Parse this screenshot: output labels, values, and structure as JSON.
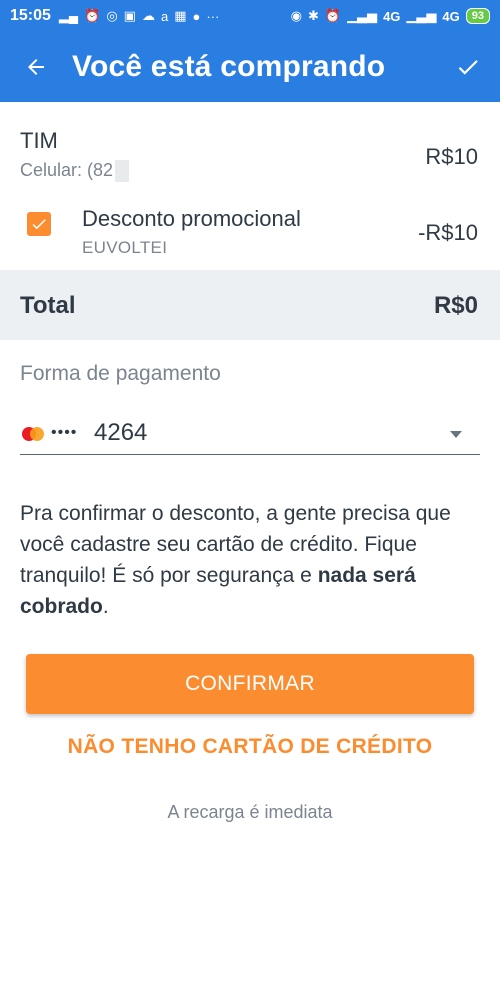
{
  "status_bar": {
    "time": "15:05",
    "left_icons": [
      "chart-icon",
      "alarm-icon",
      "whatsapp-icon",
      "notification-icon",
      "cloud-icon",
      "amazon-icon",
      "qr-icon",
      "app-icon",
      "more-dots-icon"
    ],
    "network_left": "4G",
    "network_right": "4G",
    "battery": "93"
  },
  "appbar": {
    "title": "Você está comprando"
  },
  "order": {
    "operator": "TIM",
    "phone": "Celular: (82",
    "operator_price": "R$10",
    "discount_label": "Desconto promocional",
    "discount_code": "EUVOLTEI",
    "discount_price": "-R$10",
    "total_label": "Total",
    "total_value": "R$0"
  },
  "payment": {
    "label": "Forma de pagamento",
    "card_dots": "••••",
    "card_last4": "4264"
  },
  "info": {
    "text_before": "Pra confirmar o desconto, a gente precisa que você cadastre seu cartão de crédito. Fique tranquilo! É só por segurança e ",
    "text_bold": "nada será cobrado",
    "text_after": "."
  },
  "actions": {
    "confirm": "CONFIRMAR",
    "no_card": "NÃO TENHO CARTÃO DE CRÉDITO",
    "footnote": "A recarga é imediata"
  },
  "colors": {
    "primary": "#2a7de1",
    "accent": "#fb8c2f",
    "total_bg": "#edf0f2"
  }
}
